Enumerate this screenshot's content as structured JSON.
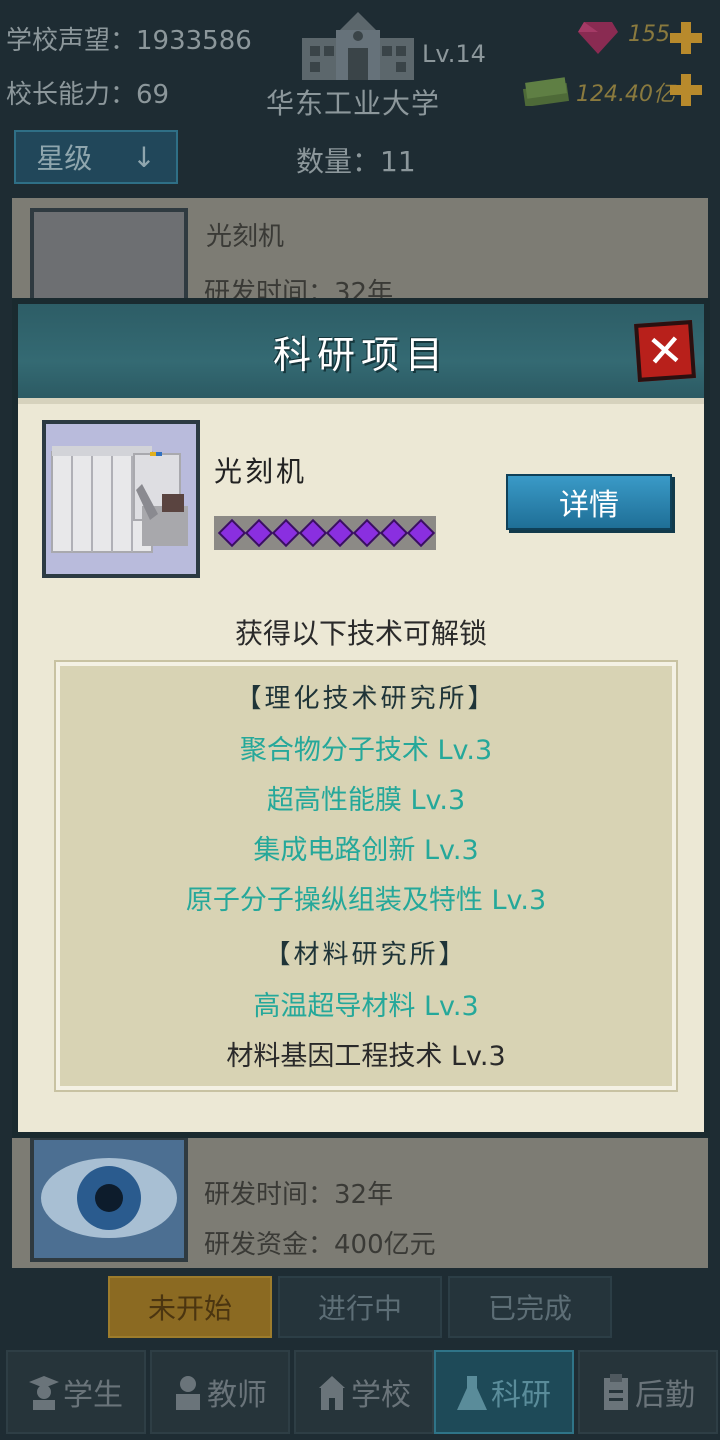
{
  "header": {
    "reputation_label": "学校声望：",
    "reputation_value": "1933586",
    "ability_label": "校长能力：",
    "ability_value": "69",
    "school_level": "Lv.14",
    "school_name": "华东工业大学",
    "gems": "155",
    "money": "124.40亿"
  },
  "list": {
    "sort_label": "星级",
    "sort_arrow": "↓",
    "count_label": "数量：",
    "count_value": "11",
    "item1": {
      "name": "光刻机",
      "time_label": "研发时间：",
      "time_value": "32年"
    },
    "item2": {
      "time_label": "研发时间：",
      "time_value": "32年",
      "fund_label": "研发资金：",
      "fund_value": "400亿元"
    }
  },
  "status_tabs": [
    "未开始",
    "进行中",
    "已完成"
  ],
  "nav": [
    "学生",
    "教师",
    "学校",
    "科研",
    "后勤"
  ],
  "modal": {
    "title": "科研项目",
    "close_label": "✕",
    "project_name": "光刻机",
    "star_count": 8,
    "detail_button": "详情",
    "unlock_label": "获得以下技术可解锁",
    "lines": [
      {
        "kind": "inst",
        "text": "【理化技术研究所】"
      },
      {
        "kind": "tech",
        "text": "聚合物分子技术 Lv.3"
      },
      {
        "kind": "tech",
        "text": "超高性能膜 Lv.3"
      },
      {
        "kind": "tech",
        "text": "集成电路创新 Lv.3"
      },
      {
        "kind": "tech",
        "text": "原子分子操纵组装及特性 Lv.3"
      },
      {
        "kind": "inst",
        "text": "【材料研究所】"
      },
      {
        "kind": "tech",
        "text": "高温超导材料 Lv.3"
      },
      {
        "kind": "tech-dark",
        "text": "材料基因工程技术 Lv.3"
      }
    ]
  },
  "colors": {
    "accent_teal": "#25a89a",
    "header_teal": "#2d5d66",
    "close_red": "#b8201b",
    "detail_blue": "#2a86b2",
    "star_purple": "#8a2fe0"
  }
}
